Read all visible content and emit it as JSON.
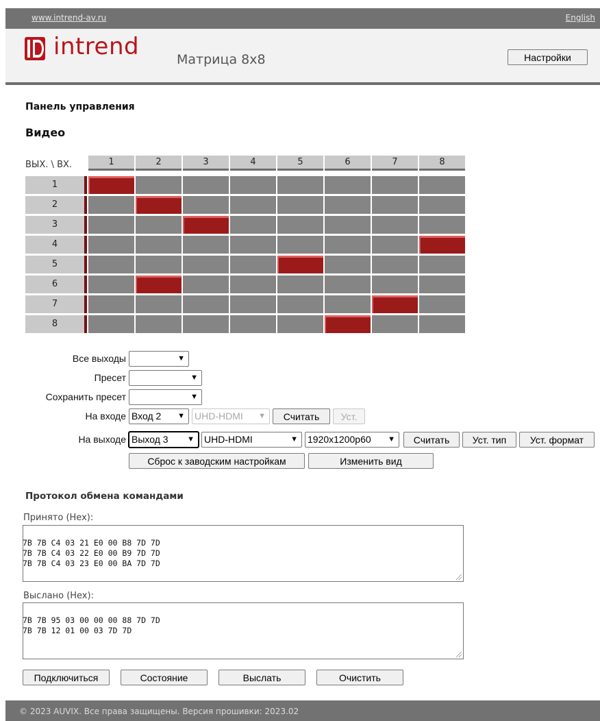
{
  "topbar": {
    "site_link": "www.intrend-av.ru",
    "lang_link": "English"
  },
  "header": {
    "brand": "intrend",
    "subtitle": "Матрица 8x8",
    "settings_button": "Настройки"
  },
  "panel_title": "Панель управления",
  "video_title": "Видео",
  "matrix": {
    "corner_label": "ВЫХ. \\ ВХ.",
    "inputs": [
      "1",
      "2",
      "3",
      "4",
      "5",
      "6",
      "7",
      "8"
    ],
    "outputs": [
      "1",
      "2",
      "3",
      "4",
      "5",
      "6",
      "7",
      "8"
    ],
    "routing": [
      1,
      2,
      3,
      8,
      5,
      2,
      7,
      6
    ],
    "active_color": "#9b1b1b",
    "cell_color": "#858585"
  },
  "form": {
    "all_outputs_label": "Все выходы",
    "all_outputs_value": "",
    "preset_label": "Пресет",
    "preset_value": "",
    "save_preset_label": "Сохранить пресет",
    "save_preset_value": "",
    "input_label": "На входе",
    "input_select": "Вход 2",
    "input_type": "UHD-HDMI",
    "input_read_button": "Считать",
    "input_set_button": "Уст.",
    "output_label": "На выходе",
    "output_select": "Выход 3",
    "output_type": "UHD-HDMI",
    "output_format": "1920x1200p60",
    "output_read_button": "Считать",
    "set_type_button": "Уст. тип",
    "set_format_button": "Уст. формат",
    "factory_reset_button": "Сброс к заводским настройкам",
    "change_view_button": "Изменить вид"
  },
  "protocol": {
    "title": "Протокол обмена командами",
    "received_label": "Принято (Hex):",
    "received_text": "7B 7B C4 03 21 E0 00 B8 7D 7D\n7B 7B C4 03 22 E0 00 B9 7D 7D\n7B 7B C4 03 23 E0 00 BA 7D 7D",
    "sent_label": "Выслано (Hex):",
    "sent_text": "7B 7B 95 03 00 00 00 88 7D 7D\n7B 7B 12 01 00 03 7D 7D",
    "connect_button": "Подключиться",
    "status_button": "Состояние",
    "send_button": "Выслать",
    "clear_button": "Очистить"
  },
  "footer": {
    "text": "© 2023 AUVIX. Все права защищены. Версия прошивки:  2023.02"
  }
}
